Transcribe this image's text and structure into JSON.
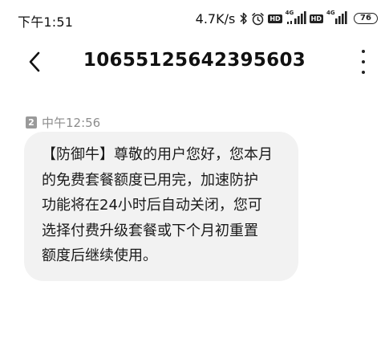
{
  "status_bar": {
    "time": "下午1:51",
    "net_speed": "4.7K/s",
    "network_label_1": "4G",
    "network_label_2": "4G",
    "hd_label": "HD",
    "battery": "76"
  },
  "header": {
    "title": "10655125642395603"
  },
  "message": {
    "sim_slot": "2",
    "time": "中午12:56",
    "lines": [
      "【防御牛】尊敬的用户您好，您本月",
      "的免费套餐额度已用完，加速防护",
      "功能将在24小时后自动关闭，您可",
      "选择付费升级套餐或下个月初重置",
      "额度后继续使用。"
    ]
  },
  "colors": {
    "bubble_bg": "#f2f2f2",
    "meta_text": "#8d8d8d",
    "sim_badge": "#9a9a9a"
  }
}
